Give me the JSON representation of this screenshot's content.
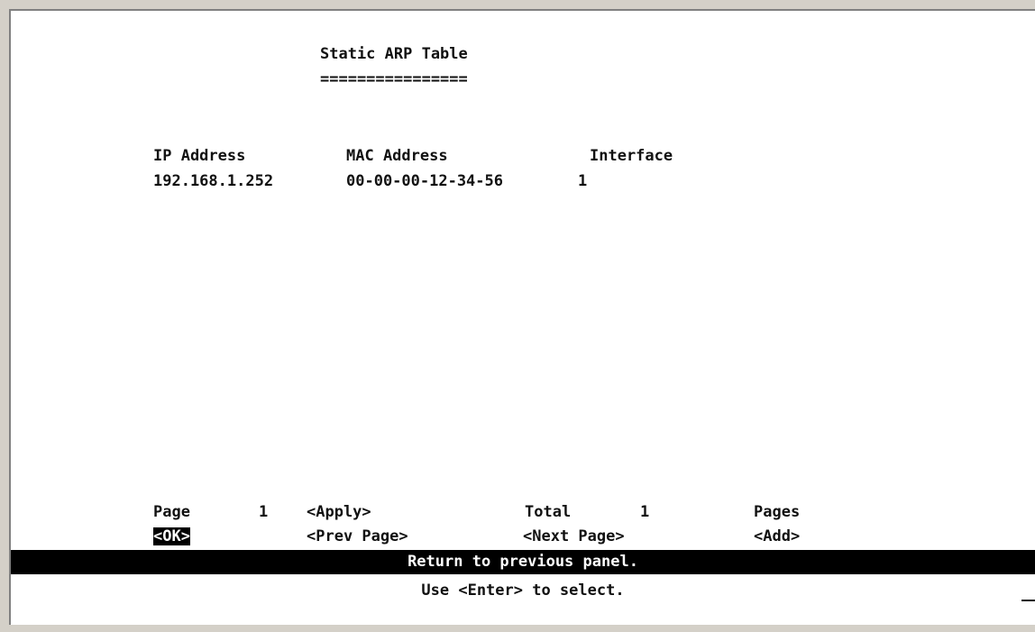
{
  "panel": {
    "title": "Static ARP Table",
    "title_underline": "================"
  },
  "table": {
    "headers": {
      "ip": "IP Address",
      "mac": "MAC Address",
      "interface": "Interface"
    },
    "rows": [
      {
        "ip": "192.168.1.252",
        "mac": "00-00-00-12-34-56",
        "interface": "1"
      }
    ]
  },
  "footer": {
    "page_label": "Page",
    "page_value": "1",
    "apply": "<Apply>",
    "total_label": "Total",
    "total_value": "1",
    "pages_label": "Pages",
    "ok": "<OK>",
    "prev_page": "<Prev Page>",
    "next_page": "<Next Page>",
    "add": "<Add>"
  },
  "status": {
    "message": "Return to previous panel.",
    "help": "Use <Enter> to select."
  },
  "colors": {
    "background": "#ffffff",
    "text": "#111111",
    "highlight_bg": "#000000",
    "highlight_text": "#ffffff",
    "window_frame": "#d4d0c8"
  }
}
